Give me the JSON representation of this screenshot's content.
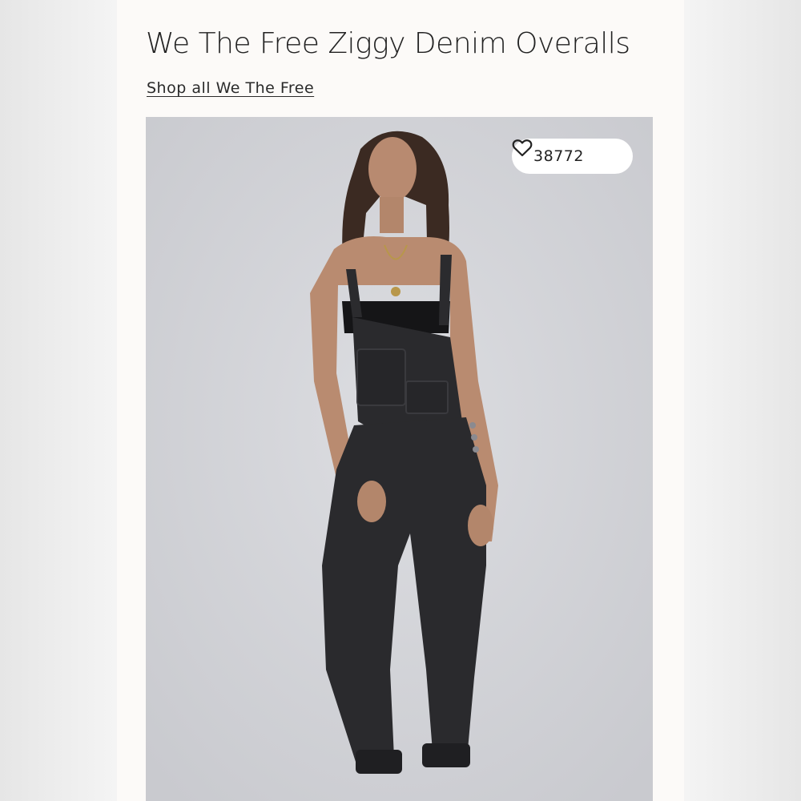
{
  "product": {
    "title": "We The Free Ziggy Denim Overalls",
    "brand_link": "Shop all We The Free"
  },
  "image": {
    "alt": "Model wearing black denim overalls",
    "favorite_count": "38772",
    "favorite_icon": "heart-outline-icon"
  },
  "colors": {
    "page_background": "#fcfaf8",
    "photo_background": "#d3d4d8",
    "denim": "#2a2a2d",
    "text": "#222222"
  }
}
